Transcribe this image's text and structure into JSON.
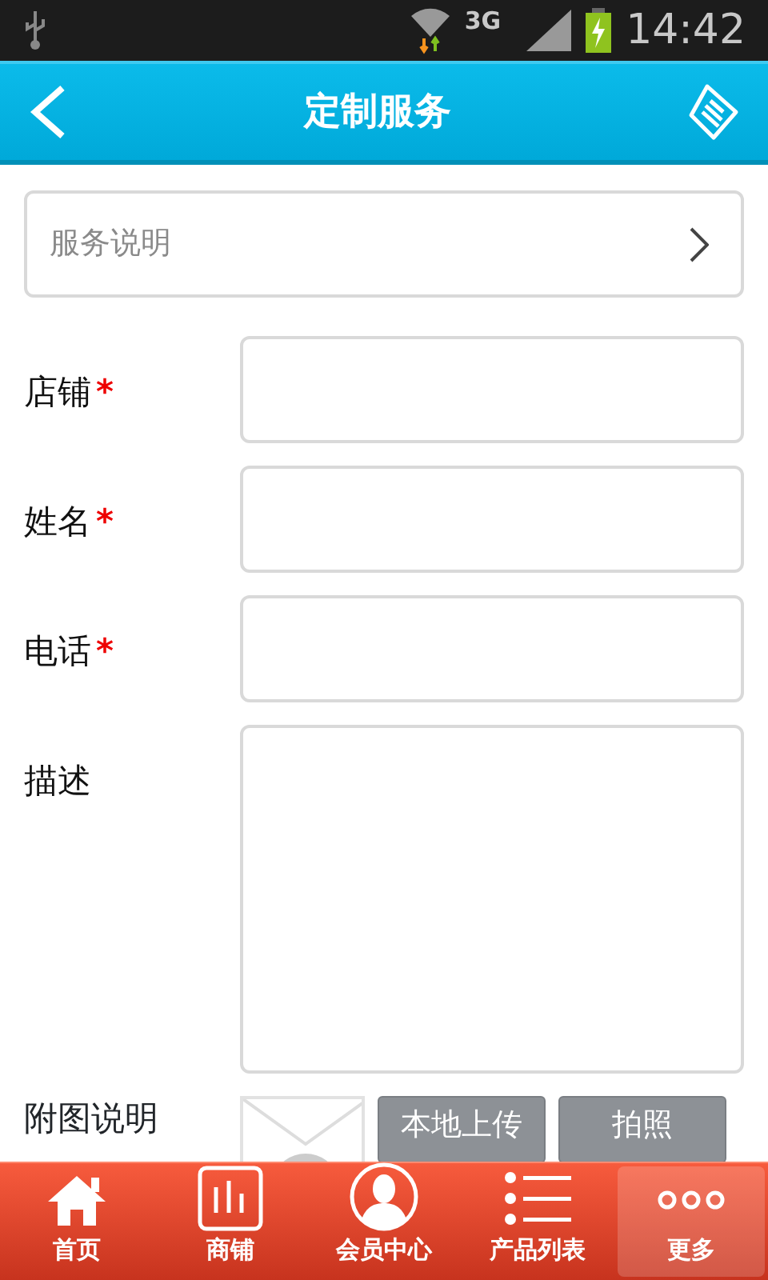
{
  "status_bar": {
    "network": "3G",
    "time": "14:42"
  },
  "header": {
    "title": "定制服务"
  },
  "service_row": {
    "label": "服务说明"
  },
  "fields": [
    {
      "label": "店铺",
      "required": true,
      "required_mark": "*",
      "kind": "text"
    },
    {
      "label": "姓名",
      "required": true,
      "required_mark": "*",
      "kind": "text"
    },
    {
      "label": "电话",
      "required": true,
      "required_mark": "*",
      "kind": "text"
    },
    {
      "label": "描述",
      "required": false,
      "kind": "textarea"
    }
  ],
  "attachment": {
    "label": "附图说明",
    "buttons": [
      "本地上传",
      "拍照"
    ]
  },
  "tab_bar": [
    {
      "label": "首页",
      "selected": false
    },
    {
      "label": "商铺",
      "selected": false
    },
    {
      "label": "会员中心",
      "selected": false
    },
    {
      "label": "产品列表",
      "selected": false
    },
    {
      "label": "更多",
      "selected": true
    }
  ]
}
